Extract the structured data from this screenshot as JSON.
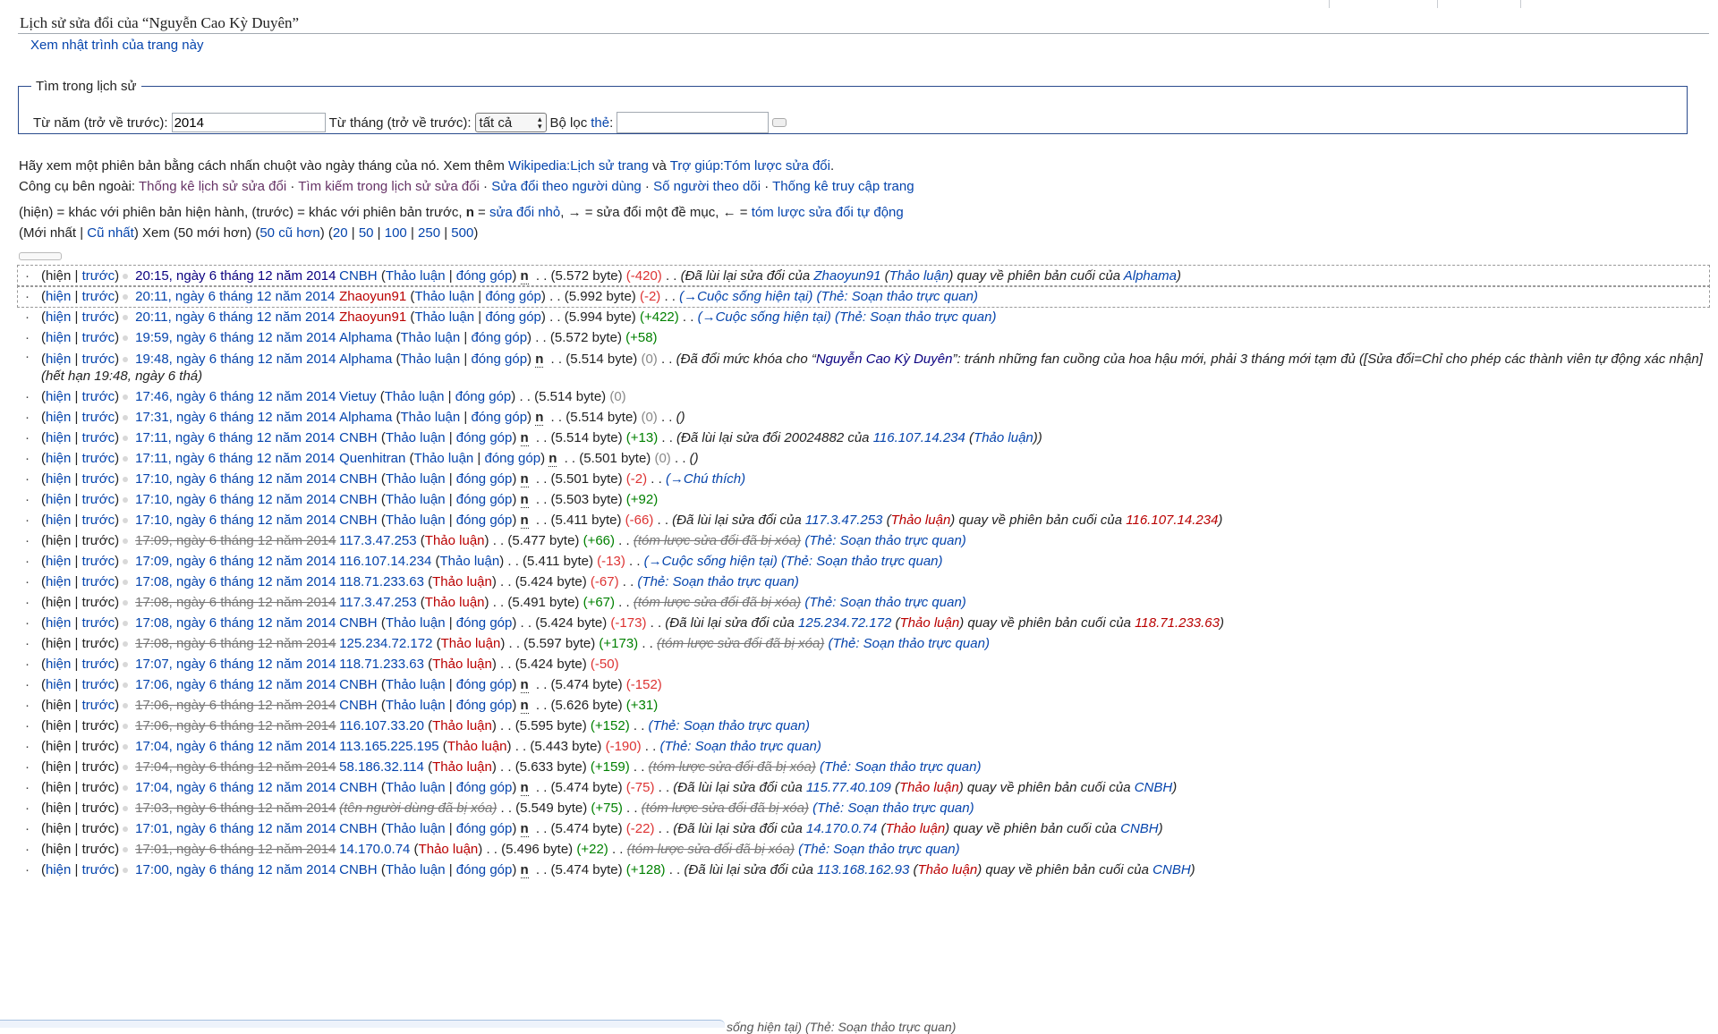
{
  "title": "Lịch sử sửa đổi của “Nguyễn Cao Kỳ Duyên”",
  "view_log": "Xem nhật trình của trang này",
  "search": {
    "legend": "Tìm trong lịch sử",
    "year_label": "Từ năm (trở về trước):",
    "year_value": "2014",
    "month_label": "Từ tháng (trở về trước):",
    "month_value": "tất cả",
    "filter_label": "Bộ lọc",
    "tag_link": "thẻ",
    "colon": ":"
  },
  "intro": {
    "t1": "Hãy xem một phiên bản bằng cách nhấn chuột vào ngày tháng của nó. Xem thêm ",
    "l1": "Wikipedia:Lịch sử trang",
    "t2": " và ",
    "l2": "Trợ giúp:Tóm lược sửa đổi",
    "t3": "."
  },
  "tools": {
    "label": "Công cụ bên ngoài: ",
    "links": [
      "Thống kê lịch sử sửa đổi",
      "Tìm kiếm trong lịch sử sửa đổi",
      "Sửa đổi theo người dùng",
      "Số người theo dõi",
      "Thống kê truy cập trang"
    ],
    "sep": " · "
  },
  "legend": {
    "t1": "(hiện) = khác với phiên bản hiện hành, (trước) = khác với phiên bản trước, ",
    "n": "n",
    "t2": " = ",
    "l1": "sửa đổi nhỏ",
    "t3": ", → = sửa đổi một đề mục, ← = ",
    "l2": "tóm lược sửa đổi tự động"
  },
  "paging": {
    "open": "(",
    "newest": "Mới nhất",
    "bar": " | ",
    "oldest": "Cũ nhất",
    "t1": ") Xem (50 mới hơn) (",
    "older": "50 cũ hơn",
    "t2": ") (",
    "sizes": [
      "20",
      "50",
      "100",
      "250",
      "500"
    ],
    "close": ")"
  },
  "labels": {
    "cur": "hiện",
    "prev": "trước",
    "talk": "Thảo luận",
    "contribs": "đóng góp",
    "minor": "n",
    "dots": " . . "
  },
  "rows": [
    {
      "cur_link": false,
      "prev_link": true,
      "time": "20:15, ngày 6 tháng 12 năm 2014",
      "user": "CNBH",
      "user_red": false,
      "talk_red": false,
      "contribs": true,
      "minor": true,
      "size": "(5.572 byte)",
      "diff": "(-420)",
      "diff_class": "neg",
      "summary": "(Đã lùi lại sửa đổi của ",
      "s_user": "Zhaoyun91",
      "s_talk": "Thảo luận",
      "s_mid": ") quay về phiên bản cuối của ",
      "s_user2": "Alphama",
      "s_end": ")",
      "selected": true,
      "first": true
    },
    {
      "cur_link": true,
      "prev_link": true,
      "time": "20:11, ngày 6 tháng 12 năm 2014",
      "user": "Zhaoyun91",
      "user_red": true,
      "talk_red": false,
      "contribs": true,
      "minor": false,
      "size": "(5.992 byte)",
      "diff": "(-2)",
      "diff_class": "neg",
      "summary": "(→Cuộc sống hiện tại) (Thẻ: Soạn thảo trực quan)",
      "summary_style": "sec",
      "selected": true
    },
    {
      "cur_link": true,
      "prev_link": true,
      "time": "20:11, ngày 6 tháng 12 năm 2014",
      "user": "Zhaoyun91",
      "user_red": true,
      "talk_red": false,
      "contribs": true,
      "minor": false,
      "size": "(5.994 byte)",
      "diff": "(+422)",
      "diff_class": "pos",
      "summary": "(→Cuộc sống hiện tại) (Thẻ: Soạn thảo trực quan)",
      "summary_style": "sec"
    },
    {
      "cur_link": true,
      "prev_link": true,
      "time": "19:59, ngày 6 tháng 12 năm 2014",
      "user": "Alphama",
      "user_red": false,
      "talk_red": false,
      "contribs": true,
      "minor": false,
      "size": "(5.572 byte)",
      "diff": "(+58)",
      "diff_class": "pos",
      "summary": ""
    },
    {
      "cur_link": true,
      "prev_link": true,
      "time": "19:48, ngày 6 tháng 12 năm 2014",
      "user": "Alphama",
      "user_red": false,
      "talk_red": false,
      "contribs": true,
      "minor": true,
      "size": "(5.514 byte)",
      "diff": "(0)",
      "diff_class": "zero",
      "summary": "(Đã đổi mức khóa cho “",
      "s_user": "Nguyễn Cao Kỳ Duyên",
      "s_mid": "”: tránh những fan cuồng của hoa hậu mới, phải 3 tháng mới tạm đủ ([Sửa đổi=Chỉ cho phép các thành viên tự động xác",
      "wrap2": "nhận] (hết hạn 19:48, ngày 6 thá)"
    },
    {
      "cur_link": true,
      "prev_link": true,
      "time": "17:46, ngày 6 tháng 12 năm 2014",
      "user": "Vietuy",
      "user_red": false,
      "talk_red": false,
      "contribs": true,
      "minor": false,
      "size": "(5.514 byte)",
      "diff": "(0)",
      "diff_class": "zero",
      "summary": ""
    },
    {
      "cur_link": true,
      "prev_link": true,
      "time": "17:31, ngày 6 tháng 12 năm 2014",
      "user": "Alphama",
      "user_red": false,
      "talk_red": false,
      "contribs": true,
      "minor": true,
      "size": "(5.514 byte)",
      "diff": "(0)",
      "diff_class": "zero",
      "summary": "()"
    },
    {
      "cur_link": true,
      "prev_link": true,
      "time": "17:11, ngày 6 tháng 12 năm 2014",
      "user": "CNBH",
      "user_red": false,
      "talk_red": false,
      "contribs": true,
      "minor": true,
      "size": "(5.514 byte)",
      "diff": "(+13)",
      "diff_class": "pos",
      "summary": "(Đã lùi lại sửa đổi 20024882 của ",
      "s_user": "116.107.14.234",
      "s_talk": "Thảo luận",
      "s_end": "))"
    },
    {
      "cur_link": true,
      "prev_link": true,
      "time": "17:11, ngày 6 tháng 12 năm 2014",
      "user": "Quenhitran",
      "user_red": false,
      "talk_red": false,
      "contribs": true,
      "minor": true,
      "size": "(5.501 byte)",
      "diff": "(0)",
      "diff_class": "zero",
      "summary": "()"
    },
    {
      "cur_link": true,
      "prev_link": true,
      "time": "17:10, ngày 6 tháng 12 năm 2014",
      "user": "CNBH",
      "user_red": false,
      "talk_red": false,
      "contribs": true,
      "minor": true,
      "size": "(5.501 byte)",
      "diff": "(-2)",
      "diff_class": "neg",
      "summary": "(→Chú thích)",
      "summary_style": "sec"
    },
    {
      "cur_link": true,
      "prev_link": true,
      "time": "17:10, ngày 6 tháng 12 năm 2014",
      "user": "CNBH",
      "user_red": false,
      "talk_red": false,
      "contribs": true,
      "minor": true,
      "size": "(5.503 byte)",
      "diff": "(+92)",
      "diff_class": "pos",
      "summary": ""
    },
    {
      "cur_link": true,
      "prev_link": true,
      "time": "17:10, ngày 6 tháng 12 năm 2014",
      "user": "CNBH",
      "user_red": false,
      "talk_red": false,
      "contribs": true,
      "minor": true,
      "size": "(5.411 byte)",
      "diff": "(-66)",
      "diff_class": "neg",
      "summary": "(Đã lùi lại sửa đổi của ",
      "s_user": "117.3.47.253",
      "s_talk": "Thảo luận",
      "s_talk_red": true,
      "s_mid": ") quay về phiên bản cuối của ",
      "s_user2": "116.107.14.234",
      "s_user2_red": true,
      "s_end": ")"
    },
    {
      "cur_link": false,
      "prev_link": false,
      "deleted_time": true,
      "time": "17:09, ngày 6 tháng 12 năm 2014",
      "user": "117.3.47.253",
      "user_red": false,
      "talk_red": true,
      "contribs": false,
      "minor": false,
      "size": "(5.477 byte)",
      "diff": "(+66)",
      "diff_class": "pos",
      "summary_deleted": "(tóm lược sửa đổi đã bị xóa)",
      "tag": "(Thẻ: Soạn thảo trực quan)"
    },
    {
      "cur_link": true,
      "prev_link": true,
      "time": "17:09, ngày 6 tháng 12 năm 2014",
      "user": "116.107.14.234",
      "user_red": false,
      "talk_red": false,
      "contribs": false,
      "minor": false,
      "size": "(5.411 byte)",
      "diff": "(-13)",
      "diff_class": "neg",
      "summary": "(→Cuộc sống hiện tại) (Thẻ: Soạn thảo trực quan)",
      "summary_style": "sec"
    },
    {
      "cur_link": true,
      "prev_link": true,
      "time": "17:08, ngày 6 tháng 12 năm 2014",
      "user": "118.71.233.63",
      "user_red": false,
      "talk_red": true,
      "contribs": false,
      "minor": false,
      "size": "(5.424 byte)",
      "diff": "(-67)",
      "diff_class": "neg",
      "tag": "(Thẻ: Soạn thảo trực quan)"
    },
    {
      "cur_link": false,
      "prev_link": false,
      "deleted_time": true,
      "time": "17:08, ngày 6 tháng 12 năm 2014",
      "user": "117.3.47.253",
      "user_red": false,
      "talk_red": true,
      "contribs": false,
      "minor": false,
      "size": "(5.491 byte)",
      "diff": "(+67)",
      "diff_class": "pos",
      "summary_deleted": "(tóm lược sửa đổi đã bị xóa)",
      "tag": "(Thẻ: Soạn thảo trực quan)"
    },
    {
      "cur_link": true,
      "prev_link": true,
      "time": "17:08, ngày 6 tháng 12 năm 2014",
      "user": "CNBH",
      "user_red": false,
      "talk_red": false,
      "contribs": true,
      "minor": false,
      "size": "(5.424 byte)",
      "diff": "(-173)",
      "diff_class": "neg",
      "summary": "(Đã lùi lại sửa đổi của ",
      "s_user": "125.234.72.172",
      "s_talk": "Thảo luận",
      "s_talk_red": true,
      "s_mid": ") quay về phiên bản cuối của ",
      "s_user2": "118.71.233.63",
      "s_user2_red": true,
      "s_end": ")"
    },
    {
      "cur_link": false,
      "prev_link": false,
      "deleted_time": true,
      "time": "17:08, ngày 6 tháng 12 năm 2014",
      "user": "125.234.72.172",
      "user_red": false,
      "talk_red": true,
      "contribs": false,
      "minor": false,
      "size": "(5.597 byte)",
      "diff": "(+173)",
      "diff_class": "pos",
      "summary_deleted": "(tóm lược sửa đổi đã bị xóa)",
      "tag": "(Thẻ: Soạn thảo trực quan)"
    },
    {
      "cur_link": true,
      "prev_link": true,
      "time": "17:07, ngày 6 tháng 12 năm 2014",
      "user": "118.71.233.63",
      "user_red": false,
      "talk_red": true,
      "contribs": false,
      "minor": false,
      "size": "(5.424 byte)",
      "diff": "(-50)",
      "diff_class": "neg",
      "summary": ""
    },
    {
      "cur_link": true,
      "prev_link": true,
      "time": "17:06, ngày 6 tháng 12 năm 2014",
      "user": "CNBH",
      "user_red": false,
      "talk_red": false,
      "contribs": true,
      "minor": true,
      "size": "(5.474 byte)",
      "diff": "(-152)",
      "diff_class": "neg",
      "summary": ""
    },
    {
      "cur_link": false,
      "prev_link": true,
      "deleted_time": true,
      "time": "17:06, ngày 6 tháng 12 năm 2014",
      "user": "CNBH",
      "user_red": false,
      "talk_red": false,
      "contribs": true,
      "minor": true,
      "size": "(5.626 byte)",
      "diff": "(+31)",
      "diff_class": "pos",
      "summary": ""
    },
    {
      "cur_link": false,
      "prev_link": false,
      "deleted_time": true,
      "time": "17:06, ngày 6 tháng 12 năm 2014",
      "user": "116.107.33.20",
      "user_red": false,
      "talk_red": true,
      "contribs": false,
      "minor": false,
      "size": "(5.595 byte)",
      "diff": "(+152)",
      "diff_class": "pos",
      "tag": "(Thẻ: Soạn thảo trực quan)"
    },
    {
      "cur_link": false,
      "prev_link": false,
      "time": "17:04, ngày 6 tháng 12 năm 2014",
      "user": "113.165.225.195",
      "user_red": false,
      "talk_red": true,
      "contribs": false,
      "minor": false,
      "size": "(5.443 byte)",
      "diff": "(-190)",
      "diff_class": "neg",
      "tag": "(Thẻ: Soạn thảo trực quan)"
    },
    {
      "cur_link": false,
      "prev_link": false,
      "deleted_time": true,
      "time": "17:04, ngày 6 tháng 12 năm 2014",
      "user": "58.186.32.114",
      "user_red": false,
      "talk_red": true,
      "contribs": false,
      "minor": false,
      "size": "(5.633 byte)",
      "diff": "(+159)",
      "diff_class": "pos",
      "summary_deleted": "(tóm lược sửa đổi đã bị xóa)",
      "tag": "(Thẻ: Soạn thảo trực quan)"
    },
    {
      "cur_link": false,
      "prev_link": false,
      "time": "17:04, ngày 6 tháng 12 năm 2014",
      "user": "CNBH",
      "user_red": false,
      "talk_red": false,
      "contribs": true,
      "minor": true,
      "size": "(5.474 byte)",
      "diff": "(-75)",
      "diff_class": "neg",
      "summary": "(Đã lùi lại sửa đổi của ",
      "s_user": "115.77.40.109",
      "s_talk": "Thảo luận",
      "s_talk_red": true,
      "s_mid": ") quay về phiên bản cuối của ",
      "s_user2": "CNBH",
      "s_end": ")"
    },
    {
      "cur_link": false,
      "prev_link": false,
      "deleted_time": true,
      "time": "17:03, ngày 6 tháng 12 năm 2014",
      "user_deleted": "(tên người dùng đã bị xóa)",
      "size": "(5.549 byte)",
      "diff": "(+75)",
      "diff_class": "pos",
      "summary_deleted": "(tóm lược sửa đổi đã bị xóa)",
      "tag": "(Thẻ: Soạn thảo trực quan)"
    },
    {
      "cur_link": false,
      "prev_link": false,
      "time": "17:01, ngày 6 tháng 12 năm 2014",
      "user": "CNBH",
      "user_red": false,
      "talk_red": false,
      "contribs": true,
      "minor": true,
      "size": "(5.474 byte)",
      "diff": "(-22)",
      "diff_class": "neg",
      "summary": "(Đã lùi lại sửa đổi của ",
      "s_user": "14.170.0.74",
      "s_talk": "Thảo luận",
      "s_talk_red": true,
      "s_mid": ") quay về phiên bản cuối của ",
      "s_user2": "CNBH",
      "s_end": ")"
    },
    {
      "cur_link": false,
      "prev_link": false,
      "deleted_time": true,
      "time": "17:01, ngày 6 tháng 12 năm 2014",
      "user": "14.170.0.74",
      "user_red": false,
      "talk_red": true,
      "contribs": false,
      "minor": false,
      "size": "(5.496 byte)",
      "diff": "(+22)",
      "diff_class": "pos",
      "summary_deleted": "(tóm lược sửa đổi đã bị xóa)",
      "tag": "(Thẻ: Soạn thảo trực quan)"
    },
    {
      "cur_link": true,
      "prev_link": true,
      "time": "17:00, ngày 6 tháng 12 năm 2014",
      "user": "CNBH",
      "user_red": false,
      "talk_red": false,
      "contribs": true,
      "minor": true,
      "size": "(5.474 byte)",
      "diff": "(+128)",
      "diff_class": "pos",
      "summary": "(Đã lùi lại sửa đổi của ",
      "s_user": "113.168.162.93",
      "s_talk": "Thảo luận",
      "s_talk_red": true,
      "s_mid": ") quay về phiên bản cuối của ",
      "s_user2": "CNBH",
      "s_end": ")"
    }
  ],
  "cutoff_text": "sống hiện tại) (Thẻ: Soạn thảo trực quan)"
}
